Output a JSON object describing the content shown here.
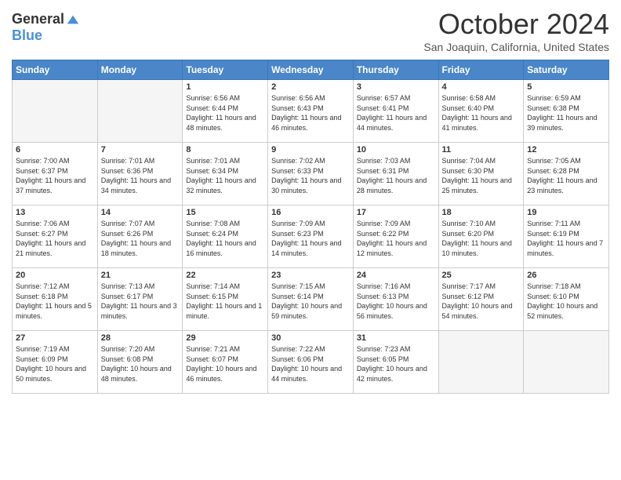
{
  "logo": {
    "general": "General",
    "blue": "Blue"
  },
  "header": {
    "month": "October 2024",
    "location": "San Joaquin, California, United States"
  },
  "weekdays": [
    "Sunday",
    "Monday",
    "Tuesday",
    "Wednesday",
    "Thursday",
    "Friday",
    "Saturday"
  ],
  "weeks": [
    [
      {
        "day": "",
        "sunrise": "",
        "sunset": "",
        "daylight": ""
      },
      {
        "day": "",
        "sunrise": "",
        "sunset": "",
        "daylight": ""
      },
      {
        "day": "1",
        "sunrise": "Sunrise: 6:56 AM",
        "sunset": "Sunset: 6:44 PM",
        "daylight": "Daylight: 11 hours and 48 minutes."
      },
      {
        "day": "2",
        "sunrise": "Sunrise: 6:56 AM",
        "sunset": "Sunset: 6:43 PM",
        "daylight": "Daylight: 11 hours and 46 minutes."
      },
      {
        "day": "3",
        "sunrise": "Sunrise: 6:57 AM",
        "sunset": "Sunset: 6:41 PM",
        "daylight": "Daylight: 11 hours and 44 minutes."
      },
      {
        "day": "4",
        "sunrise": "Sunrise: 6:58 AM",
        "sunset": "Sunset: 6:40 PM",
        "daylight": "Daylight: 11 hours and 41 minutes."
      },
      {
        "day": "5",
        "sunrise": "Sunrise: 6:59 AM",
        "sunset": "Sunset: 6:38 PM",
        "daylight": "Daylight: 11 hours and 39 minutes."
      }
    ],
    [
      {
        "day": "6",
        "sunrise": "Sunrise: 7:00 AM",
        "sunset": "Sunset: 6:37 PM",
        "daylight": "Daylight: 11 hours and 37 minutes."
      },
      {
        "day": "7",
        "sunrise": "Sunrise: 7:01 AM",
        "sunset": "Sunset: 6:36 PM",
        "daylight": "Daylight: 11 hours and 34 minutes."
      },
      {
        "day": "8",
        "sunrise": "Sunrise: 7:01 AM",
        "sunset": "Sunset: 6:34 PM",
        "daylight": "Daylight: 11 hours and 32 minutes."
      },
      {
        "day": "9",
        "sunrise": "Sunrise: 7:02 AM",
        "sunset": "Sunset: 6:33 PM",
        "daylight": "Daylight: 11 hours and 30 minutes."
      },
      {
        "day": "10",
        "sunrise": "Sunrise: 7:03 AM",
        "sunset": "Sunset: 6:31 PM",
        "daylight": "Daylight: 11 hours and 28 minutes."
      },
      {
        "day": "11",
        "sunrise": "Sunrise: 7:04 AM",
        "sunset": "Sunset: 6:30 PM",
        "daylight": "Daylight: 11 hours and 25 minutes."
      },
      {
        "day": "12",
        "sunrise": "Sunrise: 7:05 AM",
        "sunset": "Sunset: 6:28 PM",
        "daylight": "Daylight: 11 hours and 23 minutes."
      }
    ],
    [
      {
        "day": "13",
        "sunrise": "Sunrise: 7:06 AM",
        "sunset": "Sunset: 6:27 PM",
        "daylight": "Daylight: 11 hours and 21 minutes."
      },
      {
        "day": "14",
        "sunrise": "Sunrise: 7:07 AM",
        "sunset": "Sunset: 6:26 PM",
        "daylight": "Daylight: 11 hours and 18 minutes."
      },
      {
        "day": "15",
        "sunrise": "Sunrise: 7:08 AM",
        "sunset": "Sunset: 6:24 PM",
        "daylight": "Daylight: 11 hours and 16 minutes."
      },
      {
        "day": "16",
        "sunrise": "Sunrise: 7:09 AM",
        "sunset": "Sunset: 6:23 PM",
        "daylight": "Daylight: 11 hours and 14 minutes."
      },
      {
        "day": "17",
        "sunrise": "Sunrise: 7:09 AM",
        "sunset": "Sunset: 6:22 PM",
        "daylight": "Daylight: 11 hours and 12 minutes."
      },
      {
        "day": "18",
        "sunrise": "Sunrise: 7:10 AM",
        "sunset": "Sunset: 6:20 PM",
        "daylight": "Daylight: 11 hours and 10 minutes."
      },
      {
        "day": "19",
        "sunrise": "Sunrise: 7:11 AM",
        "sunset": "Sunset: 6:19 PM",
        "daylight": "Daylight: 11 hours and 7 minutes."
      }
    ],
    [
      {
        "day": "20",
        "sunrise": "Sunrise: 7:12 AM",
        "sunset": "Sunset: 6:18 PM",
        "daylight": "Daylight: 11 hours and 5 minutes."
      },
      {
        "day": "21",
        "sunrise": "Sunrise: 7:13 AM",
        "sunset": "Sunset: 6:17 PM",
        "daylight": "Daylight: 11 hours and 3 minutes."
      },
      {
        "day": "22",
        "sunrise": "Sunrise: 7:14 AM",
        "sunset": "Sunset: 6:15 PM",
        "daylight": "Daylight: 11 hours and 1 minute."
      },
      {
        "day": "23",
        "sunrise": "Sunrise: 7:15 AM",
        "sunset": "Sunset: 6:14 PM",
        "daylight": "Daylight: 10 hours and 59 minutes."
      },
      {
        "day": "24",
        "sunrise": "Sunrise: 7:16 AM",
        "sunset": "Sunset: 6:13 PM",
        "daylight": "Daylight: 10 hours and 56 minutes."
      },
      {
        "day": "25",
        "sunrise": "Sunrise: 7:17 AM",
        "sunset": "Sunset: 6:12 PM",
        "daylight": "Daylight: 10 hours and 54 minutes."
      },
      {
        "day": "26",
        "sunrise": "Sunrise: 7:18 AM",
        "sunset": "Sunset: 6:10 PM",
        "daylight": "Daylight: 10 hours and 52 minutes."
      }
    ],
    [
      {
        "day": "27",
        "sunrise": "Sunrise: 7:19 AM",
        "sunset": "Sunset: 6:09 PM",
        "daylight": "Daylight: 10 hours and 50 minutes."
      },
      {
        "day": "28",
        "sunrise": "Sunrise: 7:20 AM",
        "sunset": "Sunset: 6:08 PM",
        "daylight": "Daylight: 10 hours and 48 minutes."
      },
      {
        "day": "29",
        "sunrise": "Sunrise: 7:21 AM",
        "sunset": "Sunset: 6:07 PM",
        "daylight": "Daylight: 10 hours and 46 minutes."
      },
      {
        "day": "30",
        "sunrise": "Sunrise: 7:22 AM",
        "sunset": "Sunset: 6:06 PM",
        "daylight": "Daylight: 10 hours and 44 minutes."
      },
      {
        "day": "31",
        "sunrise": "Sunrise: 7:23 AM",
        "sunset": "Sunset: 6:05 PM",
        "daylight": "Daylight: 10 hours and 42 minutes."
      },
      {
        "day": "",
        "sunrise": "",
        "sunset": "",
        "daylight": ""
      },
      {
        "day": "",
        "sunrise": "",
        "sunset": "",
        "daylight": ""
      }
    ]
  ]
}
